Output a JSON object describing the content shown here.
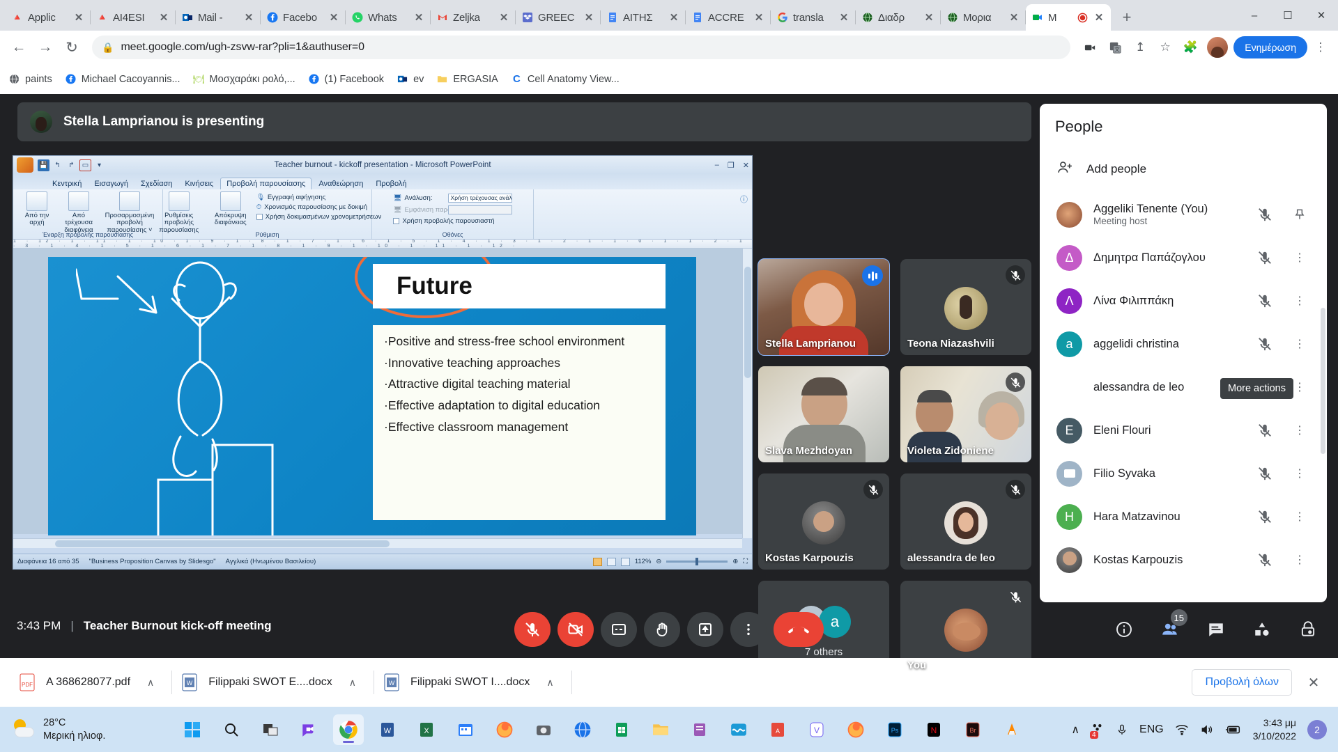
{
  "browser": {
    "tabs": [
      {
        "title": "Applic",
        "icon": "drive-icon",
        "active": false
      },
      {
        "title": "AI4ESI",
        "icon": "drive-icon",
        "active": false
      },
      {
        "title": "Mail -",
        "icon": "outlook-icon",
        "active": false
      },
      {
        "title": "Facebo",
        "icon": "facebook-icon",
        "active": false
      },
      {
        "title": "Whats",
        "icon": "whatsapp-icon",
        "active": false
      },
      {
        "title": "Zeljka",
        "icon": "gmail-icon",
        "active": false
      },
      {
        "title": "GREEC",
        "icon": "dropbox-icon",
        "active": false
      },
      {
        "title": "ΑΙΤΗΣ",
        "icon": "docs-icon",
        "active": false
      },
      {
        "title": "ACCRE",
        "icon": "docs-icon",
        "active": false
      },
      {
        "title": "transla",
        "icon": "google-icon",
        "active": false
      },
      {
        "title": "Διαδρ",
        "icon": "globe-icon",
        "active": false
      },
      {
        "title": "Μορια",
        "icon": "globe-icon",
        "active": false
      },
      {
        "title": "M",
        "icon": "meet-icon",
        "active": true,
        "recording": true
      }
    ],
    "new_tab_label": "+",
    "window_minimize": "–",
    "window_maximize": "☐",
    "window_close": "✕",
    "nav": {
      "back": "←",
      "forward": "→",
      "reload": "↻"
    },
    "url": "meet.google.com/ugh-zsvw-rar?pli=1&authuser=0",
    "lock_icon": "lock-icon",
    "update_button": "Ενημέρωση",
    "bookmarks": [
      {
        "label": "paints",
        "icon": "globe-icon"
      },
      {
        "label": "Michael Cacoyannis...",
        "icon": "facebook-icon"
      },
      {
        "label": "Μοσχαράκι ρολό,...",
        "icon": "restaurant-icon"
      },
      {
        "label": "(1) Facebook",
        "icon": "facebook-icon"
      },
      {
        "label": "ev",
        "icon": "outlook-icon"
      },
      {
        "label": "ERGASIA",
        "icon": "folder-icon"
      },
      {
        "label": "Cell Anatomy View...",
        "icon": "cell-icon"
      }
    ]
  },
  "meet": {
    "presenting_banner": "Stella Lamprianou is presenting",
    "time": "3:43 PM",
    "meeting_title": "Teacher Burnout kick-off meeting",
    "controls": [
      {
        "name": "microphone-off-button",
        "icon": "mic-off-icon",
        "state": "muted"
      },
      {
        "name": "camera-off-button",
        "icon": "camera-off-icon",
        "state": "off"
      },
      {
        "name": "captions-button",
        "icon": "cc-icon",
        "state": "normal"
      },
      {
        "name": "raise-hand-button",
        "icon": "hand-icon",
        "state": "normal"
      },
      {
        "name": "present-now-button",
        "icon": "present-icon",
        "state": "normal"
      },
      {
        "name": "more-options-button",
        "icon": "kebab-icon",
        "state": "normal"
      },
      {
        "name": "leave-call-button",
        "icon": "hangup-icon",
        "state": "hangup"
      }
    ],
    "right_controls": [
      {
        "name": "meeting-details-button",
        "icon": "info-icon",
        "badge": ""
      },
      {
        "name": "show-everyone-button",
        "icon": "people-icon",
        "badge": "15"
      },
      {
        "name": "chat-button",
        "icon": "chat-icon",
        "badge": ""
      },
      {
        "name": "activities-button",
        "icon": "activities-icon",
        "badge": ""
      },
      {
        "name": "host-controls-button",
        "icon": "host-lock-icon",
        "badge": ""
      }
    ],
    "tiles": [
      {
        "name": "Stella Lamprianou",
        "video": true,
        "muted": false,
        "speaking": true
      },
      {
        "name": "Teona Niazashvili",
        "video": false,
        "muted": true,
        "speaking": false
      },
      {
        "name": "Slava Mezhdoyan",
        "video": true,
        "muted": false,
        "speaking": false
      },
      {
        "name": "Violeta Zidoniene",
        "video": true,
        "muted": true,
        "speaking": false
      },
      {
        "name": "Kostas Karpouzis",
        "video": false,
        "muted": true,
        "speaking": false
      },
      {
        "name": "alessandra de leo",
        "video": false,
        "muted": true,
        "speaking": false
      },
      {
        "name": "7 others",
        "video": false,
        "muted": false,
        "speaking": false,
        "is_overflow": true
      },
      {
        "name": "You",
        "video": false,
        "muted": true,
        "speaking": false
      }
    ]
  },
  "people_panel": {
    "title": "People",
    "close_icon": "close-icon",
    "add_people_label": "Add people",
    "add_people_icon": "add-person-icon",
    "tooltip": "More actions",
    "participants": [
      {
        "name": "Aggeliki Tenente (You)",
        "sub": "Meeting host",
        "avatar_type": "photo",
        "avatar_color": "#8a4a32",
        "initial": "",
        "action_icon": "pin-icon"
      },
      {
        "name": "Δημητρα Παπάζογλου",
        "sub": "",
        "avatar_type": "initial",
        "avatar_color": "#c45bc7",
        "initial": "Δ",
        "action_icon": "more-icon"
      },
      {
        "name": "Λίνα Φιλιππάκη",
        "sub": "",
        "avatar_type": "initial",
        "avatar_color": "#8e24c4",
        "initial": "Λ",
        "action_icon": "more-icon"
      },
      {
        "name": "aggelidi christina",
        "sub": "",
        "avatar_type": "initial",
        "avatar_color": "#0f9aa6",
        "initial": "a",
        "action_icon": "more-icon"
      },
      {
        "name": "alessandra de leo",
        "sub": "",
        "avatar_type": "none",
        "avatar_color": "",
        "initial": "",
        "action_icon": "more-icon"
      },
      {
        "name": "Eleni Flouri",
        "sub": "",
        "avatar_type": "initial",
        "avatar_color": "#455a64",
        "initial": "E",
        "action_icon": "more-icon"
      },
      {
        "name": "Filio Syvaka",
        "sub": "",
        "avatar_type": "photo",
        "avatar_color": "#9fb4c7",
        "initial": "",
        "action_icon": "more-icon"
      },
      {
        "name": "Hara Matzavinou",
        "sub": "",
        "avatar_type": "initial",
        "avatar_color": "#4caf50",
        "initial": "H",
        "action_icon": "more-icon"
      },
      {
        "name": "Kostas Karpouzis",
        "sub": "",
        "avatar_type": "photo",
        "avatar_color": "#5a5a5a",
        "initial": "",
        "action_icon": "more-icon"
      }
    ],
    "mute_icon": "mic-off-icon"
  },
  "powerpoint": {
    "window_title": "Teacher burnout - kickoff presentation  -  Microsoft PowerPoint",
    "window_buttons": [
      "–",
      "❐",
      "✕"
    ],
    "ribbon_tabs": [
      "Κεντρική",
      "Εισαγωγή",
      "Σχεδίαση",
      "Κινήσεις",
      "Προβολή παρουσίασης",
      "Αναθεώρηση",
      "Προβολή"
    ],
    "selected_tab": "Προβολή παρουσίασης",
    "ribbon_groups": [
      {
        "label": "Έναρξη προβολής παρουσίασης",
        "buttons": [
          "Από την αρχή",
          "Από τρέχουσα διαφάνεια",
          "Προσαρμοσμένη προβολή παρουσίασης ˅"
        ]
      },
      {
        "label": "Ρύθμιση",
        "buttons": [
          "Ρυθμίσεις προβολής παρουσίασης",
          "Απόκρυψη διαφάνειας"
        ],
        "options": [
          "Εγγραφή αφήγησης",
          "Χρονισμός παρουσίασης με δοκιμή",
          "Χρήση δοκιμασμένων χρονομετρήσεων"
        ]
      },
      {
        "label": "Οθόνες",
        "options": [
          "Ανάλυση:",
          "Εμφάνιση παρουσίασης σε:",
          "Χρήση προβολής παρουσιαστή"
        ],
        "dropdown_value": "Χρήση τρέχουσας ανάλ..."
      }
    ],
    "ruler": "1 · 12 · 1 · 11 · 1 · 10 · 1 · 9 · 1 · 8 · 1 · 7 · 1 · 6 · 1 · 5 · 1 · 4 · 1 · 3 · 1 · 2 · 1 · 1 · 0 · 1 · 1 · 2 · 1 · 3 · 1 · 4 · 1 · 5 · 1 · 6 · 1 · 7 · 1 · 8 · 1 · 9 · 1 · 10 · 1 · 11 · 1 · 12 ·",
    "slide": {
      "title": "Future",
      "bullets": [
        "·Positive and stress-free  school environment",
        "·Innovative teaching approaches",
        "·Attractive digital teaching material",
        "·Effective adaptation to digital education",
        "·Effective classroom management"
      ]
    },
    "status": {
      "slide_counter": "Διαφάνεια 16 από 35",
      "theme": "\"Business Proposition Canvas by Slidesgo\"",
      "language": "Αγγλικά (Ηνωμένου Βασιλείου)",
      "zoom": "112%"
    }
  },
  "downloads_shelf": {
    "items": [
      {
        "name": "A 368628077.pdf",
        "icon": "pdf-icon"
      },
      {
        "name": "Filippaki SWOT E....docx",
        "icon": "word-icon"
      },
      {
        "name": "Filippaki SWOT I....docx",
        "icon": "word-icon"
      }
    ],
    "caret": "∧",
    "show_all": "Προβολή όλων",
    "close": "✕"
  },
  "taskbar": {
    "weather_temp": "28°C",
    "weather_desc": "Μερική ηλιοφ.",
    "apps": [
      {
        "name": "start-button",
        "icon": "windows-icon"
      },
      {
        "name": "search-button",
        "icon": "search-icon"
      },
      {
        "name": "task-view-button",
        "icon": "task-view-icon"
      },
      {
        "name": "meet-app",
        "icon": "video-chat-icon"
      },
      {
        "name": "chrome-app",
        "icon": "chrome-icon",
        "active": true
      },
      {
        "name": "word-app",
        "icon": "word-icon"
      },
      {
        "name": "excel-app",
        "icon": "excel-icon"
      },
      {
        "name": "calendar-app",
        "icon": "calendar-icon"
      },
      {
        "name": "firefox-app",
        "icon": "firefox-icon"
      },
      {
        "name": "camera-app",
        "icon": "camera-icon"
      },
      {
        "name": "browser-app",
        "icon": "globe-icon"
      },
      {
        "name": "sheets-app",
        "icon": "sheets-icon"
      },
      {
        "name": "explorer-app",
        "icon": "folder-icon"
      },
      {
        "name": "notes-app",
        "icon": "notes-icon"
      },
      {
        "name": "wave-app",
        "icon": "wave-icon"
      },
      {
        "name": "acrobat-app",
        "icon": "pdf-icon"
      },
      {
        "name": "viber-app",
        "icon": "viber-icon"
      },
      {
        "name": "firefox2-app",
        "icon": "firefox-icon"
      },
      {
        "name": "photoshop-app",
        "icon": "photoshop-icon"
      },
      {
        "name": "netflix-app",
        "icon": "netflix-icon"
      },
      {
        "name": "bridge-app",
        "icon": "bridge-icon"
      },
      {
        "name": "vlc-app",
        "icon": "vlc-icon"
      }
    ],
    "tray": {
      "chevron": "∧",
      "teams_badge": "4",
      "mic_icon": "mic-icon",
      "language": "ENG",
      "wifi_icon": "wifi-icon",
      "volume_icon": "volume-icon",
      "battery_icon": "battery-icon",
      "time": "3:43 μμ",
      "date": "3/10/2022",
      "notification_count": "2"
    }
  }
}
